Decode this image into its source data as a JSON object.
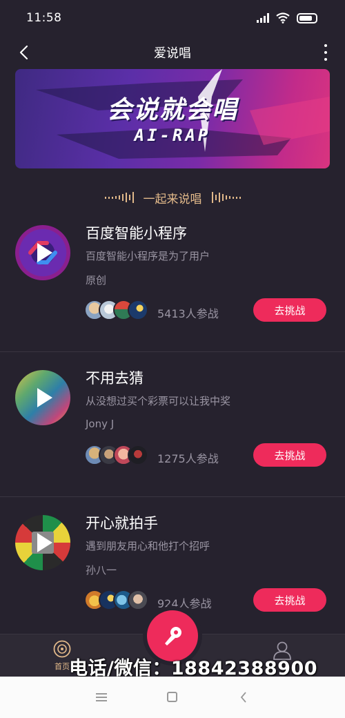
{
  "status_bar": {
    "time": "11:58"
  },
  "nav": {
    "title": "爱说唱"
  },
  "banner": {
    "title": "会说就会唱",
    "subtitle": "AI-RAP"
  },
  "section": {
    "label": "一起来说唱"
  },
  "songs": [
    {
      "title": "百度智能小程序",
      "description": "百度智能小程序是为了用户",
      "author": "原创",
      "participants": "5413人参战",
      "button": "去挑战"
    },
    {
      "title": "不用去猜",
      "description": "从没想过买个彩票可以让我中奖",
      "author": "Jony J",
      "participants": "1275人参战",
      "button": "去挑战"
    },
    {
      "title": "开心就拍手",
      "description": "遇到朋友用心和他打个招呼",
      "author": "孙八一",
      "participants": "924人参战",
      "button": "去挑战"
    }
  ],
  "tab_bar": {
    "home_label": "首页"
  },
  "watermark": "电话/微信：18842388900",
  "colors": {
    "background": "#26222e",
    "accent": "#ee2b5b",
    "gold": "#e2b98a",
    "muted_text": "#9a95a3"
  },
  "icons": [
    "back-icon",
    "more-icon",
    "play-icon",
    "record-icon",
    "microphone-icon",
    "profile-icon",
    "menu-icon",
    "home-square-icon",
    "back-arrow-icon"
  ]
}
